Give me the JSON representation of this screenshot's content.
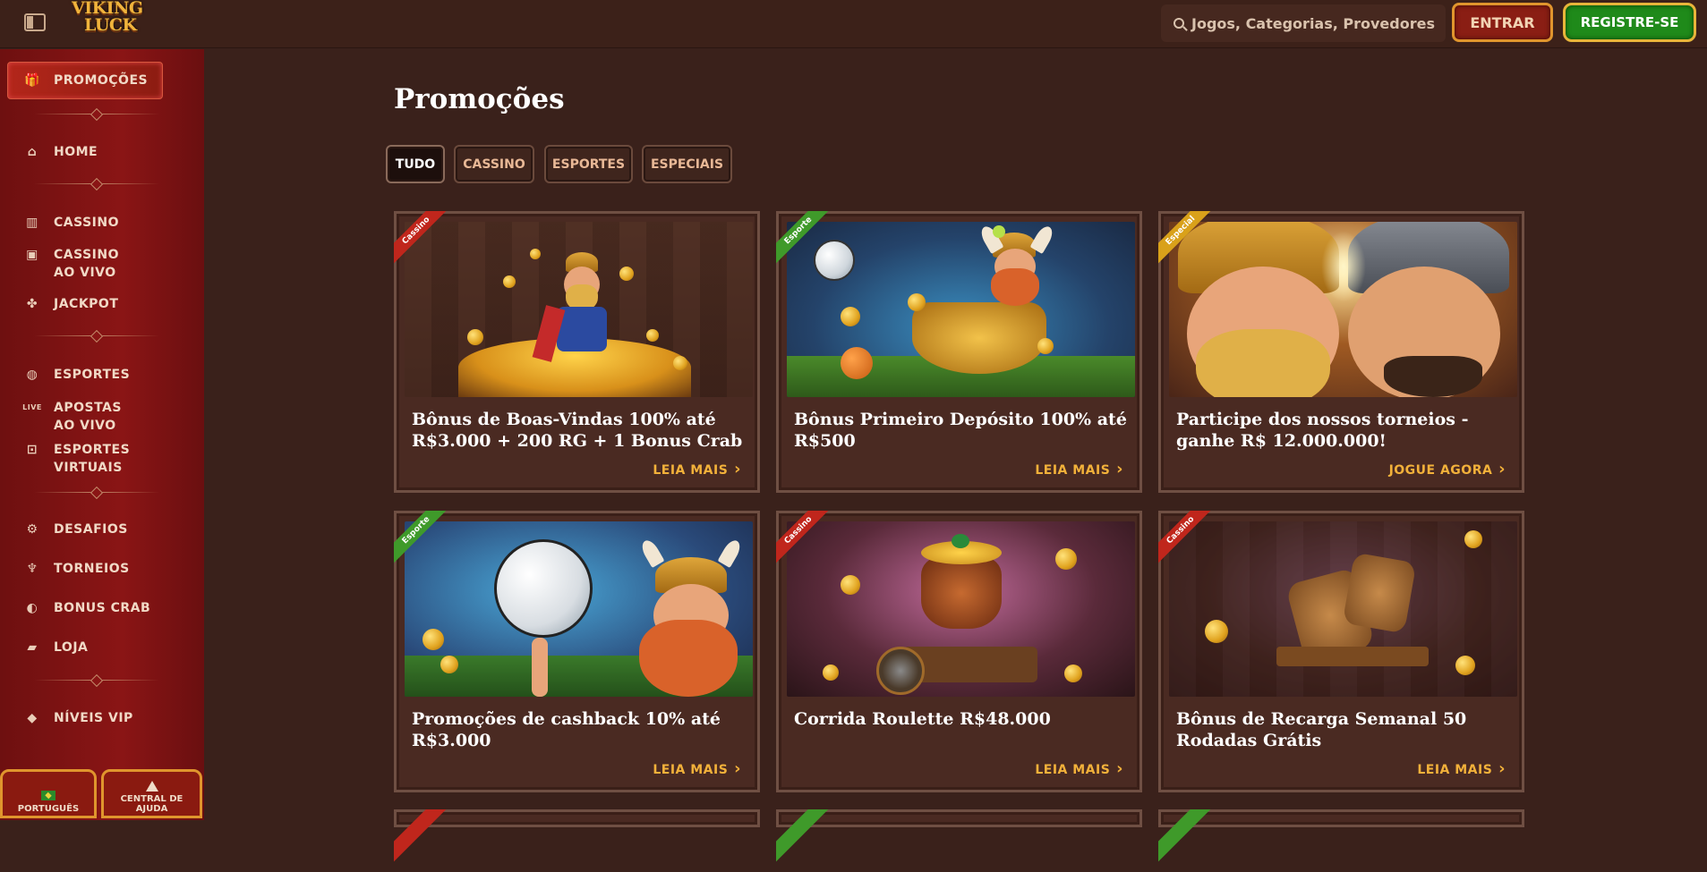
{
  "header": {
    "logo_line1": "VIKING",
    "logo_line2": "LUCK",
    "search_placeholder": "Jogos, Categorias, Provedores",
    "login_label": "ENTRAR",
    "register_label": "REGISTRE-SE"
  },
  "sidebar": {
    "items": [
      {
        "label": "Promoções",
        "icon": "gift-icon"
      },
      {
        "label": "Home",
        "icon": "home-icon"
      },
      {
        "label": "Cassino",
        "icon": "slot-machine-icon"
      },
      {
        "label": "Cassino ao vivo",
        "icon": "cards-icon"
      },
      {
        "label": "Jackpot",
        "icon": "clover-icon"
      },
      {
        "label": "Esportes",
        "icon": "ball-icon"
      },
      {
        "label": "Apostas ao vivo",
        "icon": "live-icon"
      },
      {
        "label": "Esportes virtuais",
        "icon": "virtual-icon"
      },
      {
        "label": "Desafios",
        "icon": "gear-icon"
      },
      {
        "label": "Torneios",
        "icon": "trophy-icon"
      },
      {
        "label": "Bonus Crab",
        "icon": "crab-icon"
      },
      {
        "label": "Loja",
        "icon": "bag-icon"
      },
      {
        "label": "Níveis VIP",
        "icon": "diamond-icon"
      }
    ],
    "footer": {
      "language_label": "PORTUGUÊS",
      "help_label_1": "CENTRAL DE",
      "help_label_2": "AJUDA"
    }
  },
  "main": {
    "title": "Promoções",
    "tabs": [
      "TUDO",
      "CASSINO",
      "ESPORTES",
      "ESPECIAIS"
    ],
    "active_tab": "TUDO",
    "cards": [
      {
        "tag": "Cassino",
        "tag_color": "#c0261c",
        "title": "Bônus de Boas-Vindas 100% até R$3.000 + 200 RG + 1 Bonus Crab",
        "cta": "LEIA MAIS"
      },
      {
        "tag": "Esporte",
        "tag_color": "#3f9a2a",
        "title": "Bônus Primeiro Depósito 100% até R$500",
        "cta": "LEIA MAIS"
      },
      {
        "tag": "Especial",
        "tag_color": "#d9a11a",
        "title": "Participe dos nossos torneios - ganhe R$ 12.000.000!",
        "cta": "JOGUE AGORA"
      },
      {
        "tag": "Esporte",
        "tag_color": "#3f9a2a",
        "title": "Promoções de cashback 10% até R$3.000",
        "cta": "LEIA MAIS"
      },
      {
        "tag": "Cassino",
        "tag_color": "#c0261c",
        "title": "Corrida Roulette R$48.000",
        "cta": "LEIA MAIS"
      },
      {
        "tag": "Cassino",
        "tag_color": "#c0261c",
        "title": "Bônus de Recarga Semanal 50 Rodadas Grátis",
        "cta": "LEIA MAIS"
      }
    ]
  },
  "colors": {
    "background": "#3a211b",
    "sidebar": "#8a1515",
    "accent_gold": "#f2b13a",
    "register_green": "#1f8a1a",
    "login_red": "#8a1e14"
  }
}
